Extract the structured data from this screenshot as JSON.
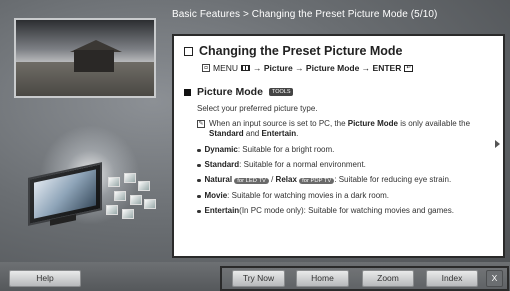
{
  "breadcrumb": "Basic Features > Changing the Preset Picture Mode (5/10)",
  "section_title": "Changing the Preset Picture Mode",
  "menu_path": {
    "menu_label": "MENU",
    "path_text": "→ Picture → Picture Mode → ENTER"
  },
  "subsection": {
    "title": "Picture Mode",
    "tools_badge": "TOOLS"
  },
  "description": "Select your preferred picture type.",
  "note": {
    "prefix": "When an input source is set to PC, the ",
    "bold1": "Picture Mode",
    "mid": " is only available the ",
    "bold2": "Standard",
    "and": " and ",
    "bold3": "Entertain",
    "end": "."
  },
  "modes": [
    {
      "name": "Dynamic",
      "text": ": Suitable for a bright room."
    },
    {
      "name": "Standard",
      "text": ": Suitable for a normal environment."
    },
    {
      "name": "Natural",
      "pill1": "for LED TV",
      "sep": " / ",
      "name2": "Relax",
      "pill2": "for PDP TV",
      "text": ": Suitable for reducing eye strain."
    },
    {
      "name": "Movie",
      "text": ": Suitable for watching movies in a dark room."
    },
    {
      "name": "Entertain",
      "text": "(In PC mode only): Suitable for watching movies and games."
    }
  ],
  "footer": {
    "help_label": "Help",
    "try_now_label": "Try Now",
    "home_label": "Home",
    "zoom_label": "Zoom",
    "index_label": "Index",
    "close_label": "X"
  }
}
